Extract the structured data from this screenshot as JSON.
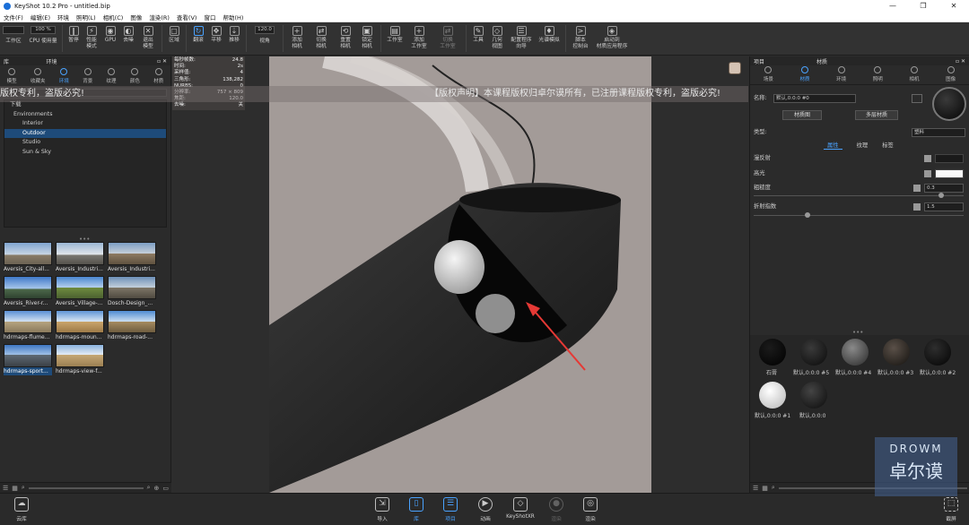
{
  "app": {
    "title": "KeyShot 10.2 Pro  - untitled.bip"
  },
  "window_buttons": [
    "—",
    "❐",
    "✕"
  ],
  "menu": [
    "文件(F)",
    "编辑(E)",
    "环境",
    "照明(L)",
    "相机(C)",
    "图像",
    "渲染(R)",
    "查看(V)",
    "窗口",
    "帮助(H)"
  ],
  "toolbar": {
    "zoom_value": "100 %",
    "fov_value": "120.0",
    "items": [
      {
        "label": "工作区",
        "icon": "workspace-icon"
      },
      {
        "label": "CPU 使用量",
        "icon": "cpu-icon"
      },
      {
        "label": "暂停",
        "icon": "pause-icon"
      },
      {
        "label": "性能\n模式",
        "icon": "performance-icon"
      },
      {
        "label": "GPU",
        "icon": "gpu-icon"
      },
      {
        "label": "去噪",
        "icon": "denoise-icon"
      },
      {
        "label": "退出\n模型",
        "icon": "exit-icon"
      },
      {
        "label": "区域",
        "icon": "region-icon"
      },
      {
        "label": "翻滚",
        "icon": "tumble-icon"
      },
      {
        "label": "平移",
        "icon": "pan-icon"
      },
      {
        "label": "推移",
        "icon": "dolly-icon"
      },
      {
        "label": "视角",
        "icon": "view-angle-icon"
      },
      {
        "label": "添加\n相机",
        "icon": "add-camera-icon"
      },
      {
        "label": "切换\n相机",
        "icon": "switch-camera-icon"
      },
      {
        "label": "重置\n相机",
        "icon": "reset-camera-icon"
      },
      {
        "label": "锁定\n相机",
        "icon": "lock-camera-icon"
      },
      {
        "label": "工作室",
        "icon": "studio-icon"
      },
      {
        "label": "添加\n工作室",
        "icon": "add-studio-icon"
      },
      {
        "label": "切换\n工作室",
        "icon": "switch-studio-icon"
      },
      {
        "label": "工具",
        "icon": "tools-icon"
      },
      {
        "label": "几何\n视图",
        "icon": "geometry-view-icon"
      },
      {
        "label": "配置程序\n向导",
        "icon": "configurator-icon"
      },
      {
        "label": "光谱模拟",
        "icon": "spectrum-icon"
      },
      {
        "label": "脚本\n控制台",
        "icon": "script-icon"
      },
      {
        "label": "启动到\n材质应用程序",
        "icon": "material-app-icon"
      }
    ]
  },
  "left_panel": {
    "header_left": "库",
    "header_title": "环境",
    "tabs": [
      "模型",
      "收藏夹",
      "环境",
      "背景",
      "纹理",
      "颜色",
      "材质"
    ],
    "tree": [
      {
        "label": "下载",
        "indent": 0
      },
      {
        "label": "Environments",
        "indent": 1
      },
      {
        "label": "Interior",
        "indent": 2
      },
      {
        "label": "Outdoor",
        "indent": 2,
        "selected": true
      },
      {
        "label": "Studio",
        "indent": 1
      },
      {
        "label": "Sun & Sky",
        "indent": 2
      }
    ],
    "thumbnails": [
      "Aversis_City-all...",
      "Aversis_Industri...",
      "Aversis_Industri...",
      "Aversis_River-r...",
      "Aversis_Village-...",
      "Dosch-Design_...",
      "hdrmaps-flume...",
      "hdrmaps-moun...",
      "hdrmaps-road-...",
      "hdrmaps-sport...",
      "hdrmaps-view-f..."
    ]
  },
  "hud": [
    [
      "每秒帧数:",
      "24.8"
    ],
    [
      "时间:",
      "2s"
    ],
    [
      "采样值:",
      "4"
    ],
    [
      "三角形:",
      "138,282"
    ],
    [
      "NURBS:",
      "0"
    ],
    [
      "分辨率:",
      "757 × 809"
    ],
    [
      "焦距:",
      "120.0"
    ],
    [
      "去噪:",
      "关"
    ]
  ],
  "watermark": {
    "left_text": "版权专利，盗版必究!",
    "right_text": "【版权声明】本课程版权归卓尔谟所有，已注册课程版权专利，盗版必究!"
  },
  "right_panel": {
    "header_left": "项目",
    "header_title": "材质",
    "tabs": [
      "场景",
      "材质",
      "环境",
      "照明",
      "相机",
      "图像"
    ],
    "name_label": "名称:",
    "name_value": "默认,0:0:0 #0",
    "btn_material_graph": "材质图",
    "btn_multi_layer": "多层材质",
    "type_label": "类型:",
    "type_value": "塑料",
    "subtabs": [
      "属性",
      "纹理",
      "标签"
    ],
    "properties": [
      {
        "label": "漫反射"
      },
      {
        "label": "高光"
      },
      {
        "label": "粗糙度",
        "value": "0.3"
      },
      {
        "label": "折射指数",
        "value": "1.5"
      }
    ],
    "swatches": [
      {
        "label": "石膏",
        "color": "#050505"
      },
      {
        "label": "默认,0:0:0 #5",
        "color": "#1a1a1a"
      },
      {
        "label": "默认,0:0:0 #4",
        "color": "#5a5a5a"
      },
      {
        "label": "默认,0:0:0 #3",
        "color": "#3a3530"
      },
      {
        "label": "默认,0:0:0 #2",
        "color": "#111111"
      },
      {
        "label": "默认,0:0:0 #1",
        "color": "#dcdcdc"
      },
      {
        "label": "默认,0:0:0",
        "color": "#222222"
      }
    ]
  },
  "bottombar": {
    "cloud": "云库",
    "items": [
      "导入",
      "库",
      "项目",
      "动画",
      "KeyShotXR",
      "渲染",
      "渲染"
    ],
    "screenshot": "截屏"
  },
  "logo": {
    "line1": "DROWM",
    "line2": "卓尔谟"
  }
}
